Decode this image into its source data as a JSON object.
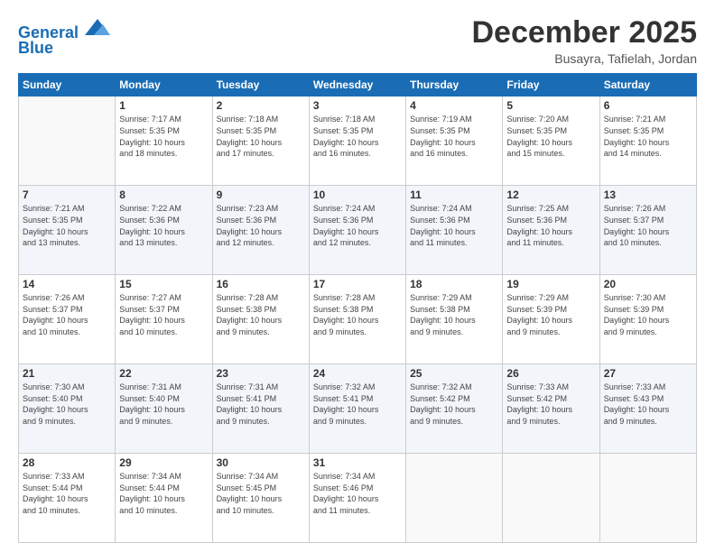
{
  "logo": {
    "line1": "General",
    "line2": "Blue"
  },
  "title": "December 2025",
  "subtitle": "Busayra, Tafielah, Jordan",
  "days_header": [
    "Sunday",
    "Monday",
    "Tuesday",
    "Wednesday",
    "Thursday",
    "Friday",
    "Saturday"
  ],
  "weeks": [
    [
      {
        "day": "",
        "info": ""
      },
      {
        "day": "1",
        "info": "Sunrise: 7:17 AM\nSunset: 5:35 PM\nDaylight: 10 hours\nand 18 minutes."
      },
      {
        "day": "2",
        "info": "Sunrise: 7:18 AM\nSunset: 5:35 PM\nDaylight: 10 hours\nand 17 minutes."
      },
      {
        "day": "3",
        "info": "Sunrise: 7:18 AM\nSunset: 5:35 PM\nDaylight: 10 hours\nand 16 minutes."
      },
      {
        "day": "4",
        "info": "Sunrise: 7:19 AM\nSunset: 5:35 PM\nDaylight: 10 hours\nand 16 minutes."
      },
      {
        "day": "5",
        "info": "Sunrise: 7:20 AM\nSunset: 5:35 PM\nDaylight: 10 hours\nand 15 minutes."
      },
      {
        "day": "6",
        "info": "Sunrise: 7:21 AM\nSunset: 5:35 PM\nDaylight: 10 hours\nand 14 minutes."
      }
    ],
    [
      {
        "day": "7",
        "info": "Sunrise: 7:21 AM\nSunset: 5:35 PM\nDaylight: 10 hours\nand 13 minutes."
      },
      {
        "day": "8",
        "info": "Sunrise: 7:22 AM\nSunset: 5:36 PM\nDaylight: 10 hours\nand 13 minutes."
      },
      {
        "day": "9",
        "info": "Sunrise: 7:23 AM\nSunset: 5:36 PM\nDaylight: 10 hours\nand 12 minutes."
      },
      {
        "day": "10",
        "info": "Sunrise: 7:24 AM\nSunset: 5:36 PM\nDaylight: 10 hours\nand 12 minutes."
      },
      {
        "day": "11",
        "info": "Sunrise: 7:24 AM\nSunset: 5:36 PM\nDaylight: 10 hours\nand 11 minutes."
      },
      {
        "day": "12",
        "info": "Sunrise: 7:25 AM\nSunset: 5:36 PM\nDaylight: 10 hours\nand 11 minutes."
      },
      {
        "day": "13",
        "info": "Sunrise: 7:26 AM\nSunset: 5:37 PM\nDaylight: 10 hours\nand 10 minutes."
      }
    ],
    [
      {
        "day": "14",
        "info": "Sunrise: 7:26 AM\nSunset: 5:37 PM\nDaylight: 10 hours\nand 10 minutes."
      },
      {
        "day": "15",
        "info": "Sunrise: 7:27 AM\nSunset: 5:37 PM\nDaylight: 10 hours\nand 10 minutes."
      },
      {
        "day": "16",
        "info": "Sunrise: 7:28 AM\nSunset: 5:38 PM\nDaylight: 10 hours\nand 9 minutes."
      },
      {
        "day": "17",
        "info": "Sunrise: 7:28 AM\nSunset: 5:38 PM\nDaylight: 10 hours\nand 9 minutes."
      },
      {
        "day": "18",
        "info": "Sunrise: 7:29 AM\nSunset: 5:38 PM\nDaylight: 10 hours\nand 9 minutes."
      },
      {
        "day": "19",
        "info": "Sunrise: 7:29 AM\nSunset: 5:39 PM\nDaylight: 10 hours\nand 9 minutes."
      },
      {
        "day": "20",
        "info": "Sunrise: 7:30 AM\nSunset: 5:39 PM\nDaylight: 10 hours\nand 9 minutes."
      }
    ],
    [
      {
        "day": "21",
        "info": "Sunrise: 7:30 AM\nSunset: 5:40 PM\nDaylight: 10 hours\nand 9 minutes."
      },
      {
        "day": "22",
        "info": "Sunrise: 7:31 AM\nSunset: 5:40 PM\nDaylight: 10 hours\nand 9 minutes."
      },
      {
        "day": "23",
        "info": "Sunrise: 7:31 AM\nSunset: 5:41 PM\nDaylight: 10 hours\nand 9 minutes."
      },
      {
        "day": "24",
        "info": "Sunrise: 7:32 AM\nSunset: 5:41 PM\nDaylight: 10 hours\nand 9 minutes."
      },
      {
        "day": "25",
        "info": "Sunrise: 7:32 AM\nSunset: 5:42 PM\nDaylight: 10 hours\nand 9 minutes."
      },
      {
        "day": "26",
        "info": "Sunrise: 7:33 AM\nSunset: 5:42 PM\nDaylight: 10 hours\nand 9 minutes."
      },
      {
        "day": "27",
        "info": "Sunrise: 7:33 AM\nSunset: 5:43 PM\nDaylight: 10 hours\nand 9 minutes."
      }
    ],
    [
      {
        "day": "28",
        "info": "Sunrise: 7:33 AM\nSunset: 5:44 PM\nDaylight: 10 hours\nand 10 minutes."
      },
      {
        "day": "29",
        "info": "Sunrise: 7:34 AM\nSunset: 5:44 PM\nDaylight: 10 hours\nand 10 minutes."
      },
      {
        "day": "30",
        "info": "Sunrise: 7:34 AM\nSunset: 5:45 PM\nDaylight: 10 hours\nand 10 minutes."
      },
      {
        "day": "31",
        "info": "Sunrise: 7:34 AM\nSunset: 5:46 PM\nDaylight: 10 hours\nand 11 minutes."
      },
      {
        "day": "",
        "info": ""
      },
      {
        "day": "",
        "info": ""
      },
      {
        "day": "",
        "info": ""
      }
    ]
  ]
}
